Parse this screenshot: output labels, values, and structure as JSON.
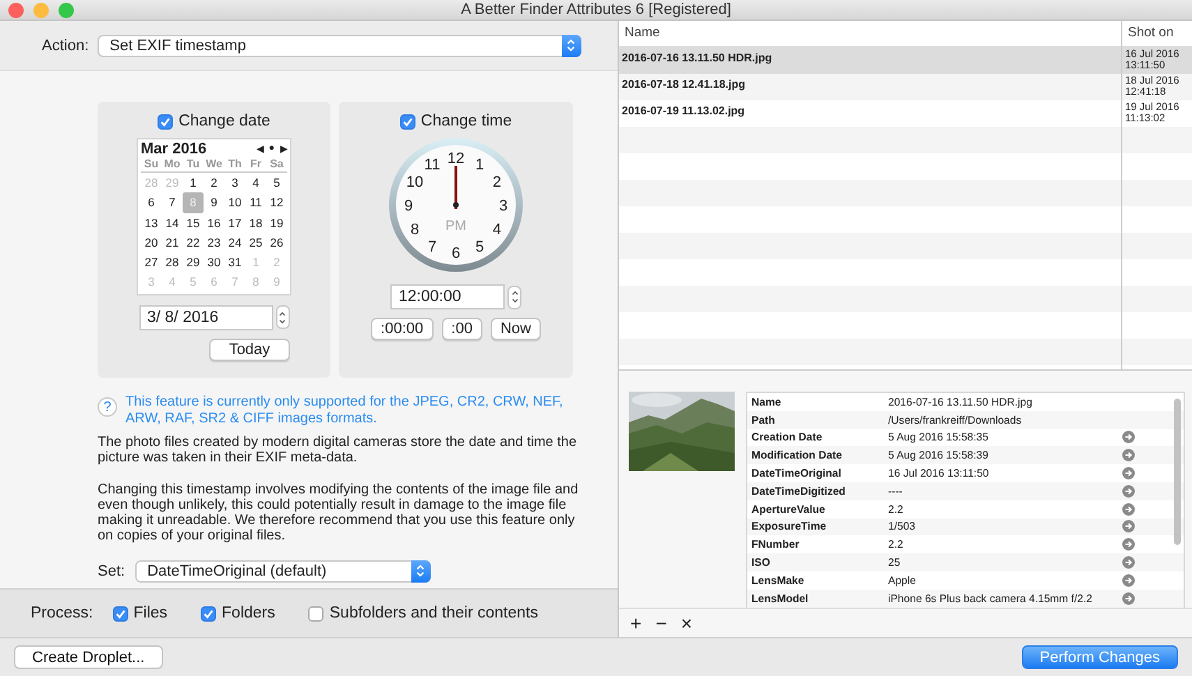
{
  "window": {
    "title": "A Better Finder Attributes 6 [Registered]"
  },
  "action": {
    "label": "Action:",
    "value": "Set EXIF timestamp"
  },
  "date_panel": {
    "checkbox": {
      "label": "Change date",
      "checked": true
    },
    "month": "Mar 2016",
    "nav": [
      "◀",
      "●",
      "▶"
    ],
    "weekdays": [
      "Su",
      "Mo",
      "Tu",
      "We",
      "Th",
      "Fr",
      "Sa"
    ],
    "weeks": [
      [
        {
          "day": "28",
          "in_month": false,
          "selected": false
        },
        {
          "day": "29",
          "in_month": false,
          "selected": false
        },
        {
          "day": "1",
          "in_month": true,
          "selected": false
        },
        {
          "day": "2",
          "in_month": true,
          "selected": false
        },
        {
          "day": "3",
          "in_month": true,
          "selected": false
        },
        {
          "day": "4",
          "in_month": true,
          "selected": false
        },
        {
          "day": "5",
          "in_month": true,
          "selected": false
        }
      ],
      [
        {
          "day": "6",
          "in_month": true,
          "selected": false
        },
        {
          "day": "7",
          "in_month": true,
          "selected": false
        },
        {
          "day": "8",
          "in_month": true,
          "selected": true
        },
        {
          "day": "9",
          "in_month": true,
          "selected": false
        },
        {
          "day": "10",
          "in_month": true,
          "selected": false
        },
        {
          "day": "11",
          "in_month": true,
          "selected": false
        },
        {
          "day": "12",
          "in_month": true,
          "selected": false
        }
      ],
      [
        {
          "day": "13",
          "in_month": true,
          "selected": false
        },
        {
          "day": "14",
          "in_month": true,
          "selected": false
        },
        {
          "day": "15",
          "in_month": true,
          "selected": false
        },
        {
          "day": "16",
          "in_month": true,
          "selected": false
        },
        {
          "day": "17",
          "in_month": true,
          "selected": false
        },
        {
          "day": "18",
          "in_month": true,
          "selected": false
        },
        {
          "day": "19",
          "in_month": true,
          "selected": false
        }
      ],
      [
        {
          "day": "20",
          "in_month": true,
          "selected": false
        },
        {
          "day": "21",
          "in_month": true,
          "selected": false
        },
        {
          "day": "22",
          "in_month": true,
          "selected": false
        },
        {
          "day": "23",
          "in_month": true,
          "selected": false
        },
        {
          "day": "24",
          "in_month": true,
          "selected": false
        },
        {
          "day": "25",
          "in_month": true,
          "selected": false
        },
        {
          "day": "26",
          "in_month": true,
          "selected": false
        }
      ],
      [
        {
          "day": "27",
          "in_month": true,
          "selected": false
        },
        {
          "day": "28",
          "in_month": true,
          "selected": false
        },
        {
          "day": "29",
          "in_month": true,
          "selected": false
        },
        {
          "day": "30",
          "in_month": true,
          "selected": false
        },
        {
          "day": "31",
          "in_month": true,
          "selected": false
        },
        {
          "day": "1",
          "in_month": false,
          "selected": false
        },
        {
          "day": "2",
          "in_month": false,
          "selected": false
        }
      ],
      [
        {
          "day": "3",
          "in_month": false,
          "selected": false
        },
        {
          "day": "4",
          "in_month": false,
          "selected": false
        },
        {
          "day": "5",
          "in_month": false,
          "selected": false
        },
        {
          "day": "6",
          "in_month": false,
          "selected": false
        },
        {
          "day": "7",
          "in_month": false,
          "selected": false
        },
        {
          "day": "8",
          "in_month": false,
          "selected": false
        },
        {
          "day": "9",
          "in_month": false,
          "selected": false
        }
      ]
    ],
    "date_field": "3/  8/ 2016",
    "today_button": "Today"
  },
  "time_panel": {
    "checkbox": {
      "label": "Change time",
      "checked": true
    },
    "clock": {
      "numerals": [
        "12",
        "11",
        "1",
        "10",
        "2",
        "9",
        "3",
        "8",
        "4",
        "7",
        "5",
        "6"
      ],
      "period": "PM"
    },
    "time_field": "12:00:00",
    "buttons": [
      ":00:00",
      ":00",
      "Now"
    ]
  },
  "help_icon": "?",
  "note": "This feature is currently only supported for the JPEG, CR2, CRW, NEF, ARW, RAF, SR2 & CIFF images formats.",
  "paragraphs": [
    "The photo files created by modern digital cameras store the date and time the picture was taken in their EXIF meta-data.",
    "Changing this timestamp involves modifying the contents of the image file and even though unlikely, this could potentially result in damage to the image file making it unreadable. We therefore recommend that you use this feature only on copies of your original files."
  ],
  "set": {
    "label": "Set:",
    "value": "DateTimeOriginal (default)"
  },
  "process": {
    "label": "Process:",
    "options": [
      {
        "label": "Files",
        "checked": true
      },
      {
        "label": "Folders",
        "checked": true
      },
      {
        "label": "Subfolders and their contents",
        "checked": false
      }
    ]
  },
  "file_table": {
    "columns": [
      "Name",
      "Shot on"
    ],
    "rows": [
      {
        "name": "2016-07-16 13.11.50 HDR.jpg",
        "shot_on": [
          "16 Jul 2016",
          "13:11:50"
        ],
        "selected": true
      },
      {
        "name": "2016-07-18 12.41.18.jpg",
        "shot_on": [
          "18 Jul 2016",
          "12:41:18"
        ],
        "selected": false
      },
      {
        "name": "2016-07-19 11.13.02.jpg",
        "shot_on": [
          "19 Jul 2016",
          "11:13:02"
        ],
        "selected": false
      }
    ]
  },
  "preview": {
    "kind": "picture"
  },
  "details": [
    {
      "name": "Name",
      "value": "2016-07-16 13.11.50 HDR.jpg",
      "kind": "plain"
    },
    {
      "name": "Path",
      "value": "/Users/frankreiff/Downloads",
      "kind": "plain"
    },
    {
      "name": "Creation Date",
      "value": "5 Aug 2016 15:58:35",
      "kind": "link"
    },
    {
      "name": "Modification Date",
      "value": "5 Aug 2016 15:58:39",
      "kind": "link"
    },
    {
      "name": "DateTimeOriginal",
      "value": "16 Jul 2016 13:11:50",
      "kind": "link"
    },
    {
      "name": "DateTimeDigitized",
      "value": "----",
      "kind": "link"
    },
    {
      "name": "ApertureValue",
      "value": "2.2",
      "kind": "link"
    },
    {
      "name": "ExposureTime",
      "value": "1/503",
      "kind": "link"
    },
    {
      "name": "FNumber",
      "value": "2.2",
      "kind": "link"
    },
    {
      "name": "ISO",
      "value": "25",
      "kind": "link"
    },
    {
      "name": "LensMake",
      "value": "Apple",
      "kind": "link"
    },
    {
      "name": "LensModel",
      "value": "iPhone 6s Plus back camera 4.15mm f/2.2",
      "kind": "link"
    }
  ],
  "list_tools": [
    "+",
    "−",
    "×"
  ],
  "buttons": [
    {
      "label": "Create Droplet...",
      "kind": "normal"
    },
    {
      "label": "Perform Changes",
      "kind": "default"
    }
  ]
}
